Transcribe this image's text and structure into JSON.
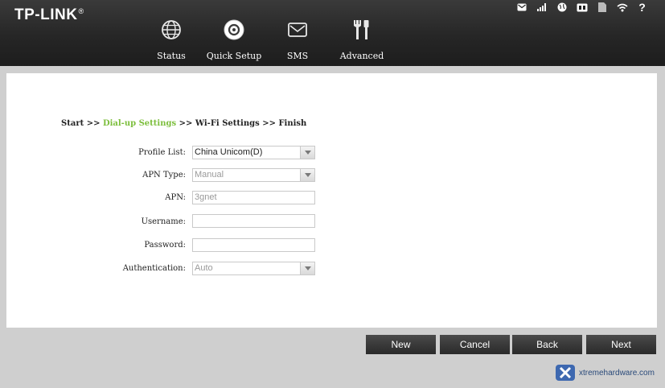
{
  "brand": {
    "logo_text": "TP-LINK",
    "trademark": "®"
  },
  "nav": {
    "status": "Status",
    "quick_setup": "Quick Setup",
    "sms": "SMS",
    "advanced": "Advanced"
  },
  "status_bar": {
    "help": "?"
  },
  "breadcrumb": {
    "start": "Start >> ",
    "dialup": "Dial-up Settings",
    "rest": " >> Wi-Fi Settings >> Finish"
  },
  "form": {
    "profile_list": {
      "label": "Profile List:",
      "value": "China Unicom(D)"
    },
    "apn_type": {
      "label": "APN Type:",
      "value": "Manual"
    },
    "apn": {
      "label": "APN:",
      "value": "3gnet"
    },
    "username": {
      "label": "Username:",
      "value": ""
    },
    "password": {
      "label": "Password:",
      "value": ""
    },
    "authentication": {
      "label": "Authentication:",
      "value": "Auto"
    }
  },
  "buttons": {
    "new": "New",
    "cancel": "Cancel",
    "back": "Back",
    "next": "Next"
  },
  "watermark": {
    "text": "xtremehardware.com"
  },
  "colors": {
    "accent_green": "#7cbe3c",
    "header_bg": "#262626",
    "button_bg": "#333333"
  }
}
